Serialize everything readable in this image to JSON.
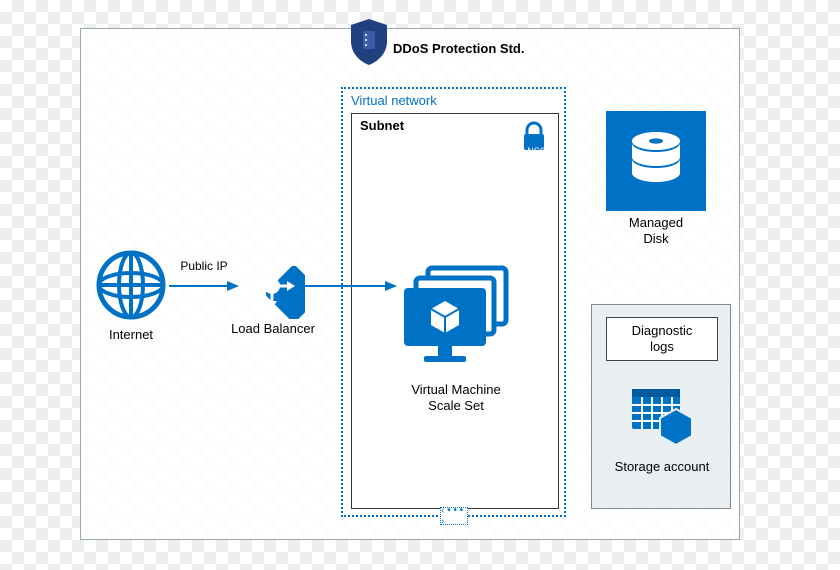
{
  "ddos_label": "DDoS Protection Std.",
  "vnet_label": "Virtual network",
  "subnet_label": "Subnet",
  "nsg_label": "NSG",
  "internet_label": "Internet",
  "public_ip_label": "Public IP",
  "load_balancer_label": "Load Balancer",
  "vmss_label_line1": "Virtual Machine",
  "vmss_label_line2": "Scale Set",
  "managed_disk_label_line1": "Managed",
  "managed_disk_label_line2": "Disk",
  "diag_logs_label_line1": "Diagnostic",
  "diag_logs_label_line2": "logs",
  "storage_account_label": "Storage account",
  "move_handle": "‹ • • • ›",
  "colors": {
    "azure_blue": "#0072C6",
    "dark_blue": "#204080"
  }
}
